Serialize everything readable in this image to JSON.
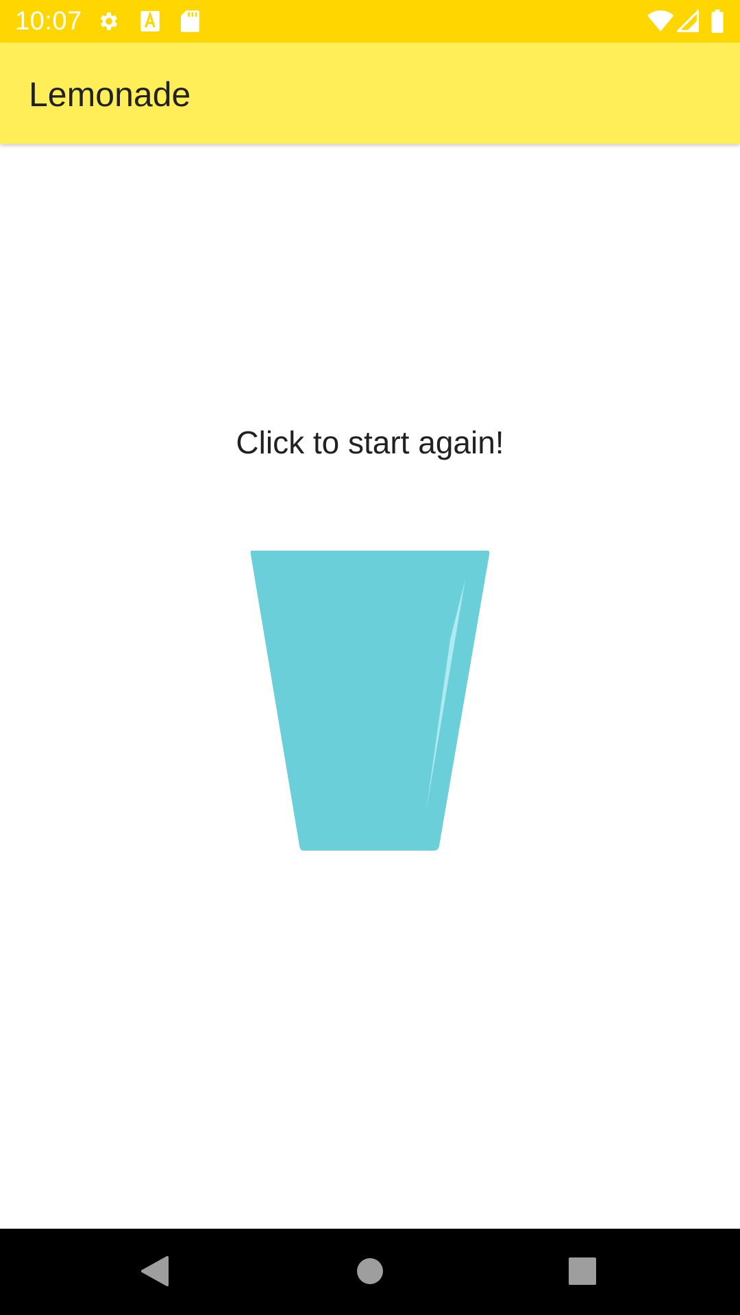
{
  "status_bar": {
    "time": "10:07",
    "background": "#FFD600",
    "left_icons": [
      "gear-icon",
      "text-a-icon",
      "sd-card-icon"
    ],
    "right_icons": [
      "wifi-icon",
      "signal-icon",
      "battery-icon"
    ]
  },
  "app_bar": {
    "title": "Lemonade",
    "background": "#FFEE58"
  },
  "main": {
    "instruction": "Click to start again!",
    "image": {
      "icon": "empty-glass-icon",
      "color": "#6BCFDA"
    }
  },
  "nav_bar": {
    "buttons": [
      "back-icon",
      "home-icon",
      "recents-icon"
    ]
  }
}
